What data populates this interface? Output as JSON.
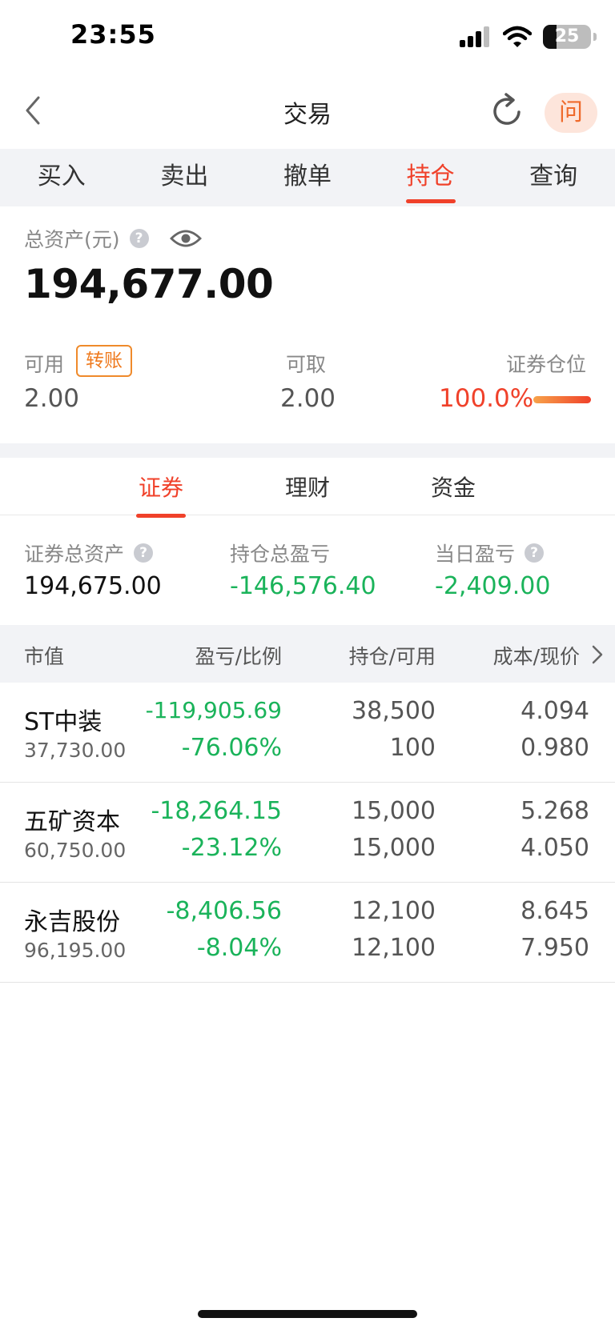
{
  "status": {
    "time": "23:55",
    "battery": "25"
  },
  "header": {
    "title": "交易",
    "ask_label": "问"
  },
  "trade_tabs": [
    "买入",
    "卖出",
    "撤单",
    "持仓",
    "查询"
  ],
  "summary": {
    "total_label": "总资产(元)",
    "total_value": "194,677.00",
    "available_label": "可用",
    "transfer_label": "转账",
    "available_value": "2.00",
    "withdrawable_label": "可取",
    "withdrawable_value": "2.00",
    "position_label": "证券仓位",
    "position_value": "100.0%",
    "position_fraction": 1.0
  },
  "sub_tabs": [
    "证券",
    "理财",
    "资金"
  ],
  "securities": {
    "total_label": "证券总资产",
    "total_value": "194,675.00",
    "holding_pl_label": "持仓总盈亏",
    "holding_pl_value": "-146,576.40",
    "daily_pl_label": "当日盈亏",
    "daily_pl_value": "-2,409.00"
  },
  "table": {
    "columns": [
      "市值",
      "盈亏/比例",
      "持仓/可用",
      "成本/现价"
    ],
    "rows": [
      {
        "name": "ST中装",
        "market_value": "37,730.00",
        "pl": "-119,905.69",
        "ratio": "-76.06%",
        "holding": "38,500",
        "available": "100",
        "cost": "4.094",
        "price": "0.980"
      },
      {
        "name": "五矿资本",
        "market_value": "60,750.00",
        "pl": "-18,264.15",
        "ratio": "-23.12%",
        "holding": "15,000",
        "available": "15,000",
        "cost": "5.268",
        "price": "4.050"
      },
      {
        "name": "永吉股份",
        "market_value": "96,195.00",
        "pl": "-8,406.56",
        "ratio": "-8.04%",
        "holding": "12,100",
        "available": "12,100",
        "cost": "8.645",
        "price": "7.950"
      }
    ]
  },
  "colors": {
    "accent_red": "#f0412a",
    "loss_green": "#1ab35a",
    "orange": "#ef7a1e"
  }
}
